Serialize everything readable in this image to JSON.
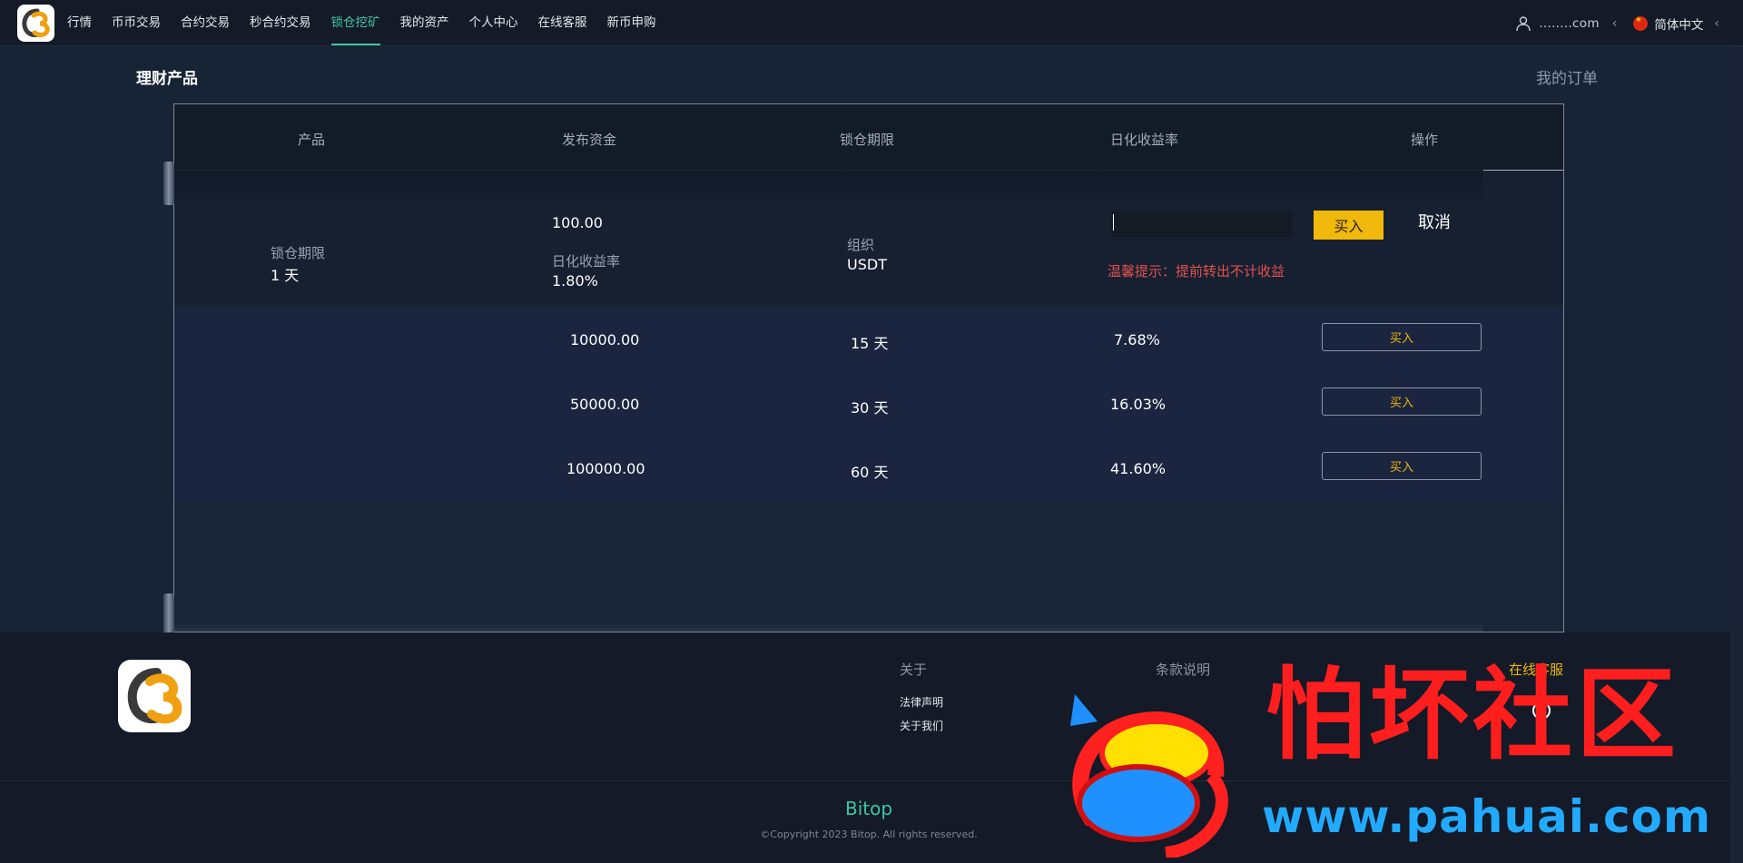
{
  "nav": {
    "items": [
      {
        "label": "行情",
        "active": false
      },
      {
        "label": "币币交易",
        "active": false
      },
      {
        "label": "合约交易",
        "active": false
      },
      {
        "label": "秒合约交易",
        "active": false
      },
      {
        "label": "锁仓挖矿",
        "active": true
      },
      {
        "label": "我的资产",
        "active": false
      },
      {
        "label": "个人中心",
        "active": false
      },
      {
        "label": "在线客服",
        "active": false
      },
      {
        "label": "新币申购",
        "active": false
      }
    ],
    "user": "........com",
    "chevron": "‹",
    "language": "简体中文",
    "accent_color": "#3cc7a2"
  },
  "page": {
    "title": "理财产品",
    "my_orders": "我的订单"
  },
  "table": {
    "headers": [
      "产品",
      "发布资金",
      "锁仓期限",
      "日化收益率",
      "操作"
    ],
    "expanded": {
      "lock_label": "锁仓期限",
      "lock_value": "1 天",
      "amount": "100.00",
      "rate_label": "日化收益率",
      "rate_value": "1.80%",
      "org_label": "组织",
      "org_value": "USDT",
      "buy_label": "买入",
      "cancel_label": "取消",
      "tip": "温馨提示：提前转出不计收益"
    },
    "rows": [
      {
        "amount": "10000.00",
        "period": "15 天",
        "rate": "7.68%",
        "action": "买入"
      },
      {
        "amount": "50000.00",
        "period": "30 天",
        "rate": "16.03%",
        "action": "买入"
      },
      {
        "amount": "100000.00",
        "period": "60 天",
        "rate": "41.60%",
        "action": "买入"
      }
    ]
  },
  "footer": {
    "about": "关于",
    "legal": "法律声明",
    "about_us": "关于我们",
    "terms": "条款说明",
    "service": "在线客服",
    "brand": "Bitop",
    "copyright": "©Copyright 2023 Bitop. All rights reserved."
  },
  "watermark": {
    "cn": "怕坏社区",
    "url": "www.pahuai.com"
  },
  "colors": {
    "buy": "#f0b90b",
    "tip": "#e2514f"
  }
}
